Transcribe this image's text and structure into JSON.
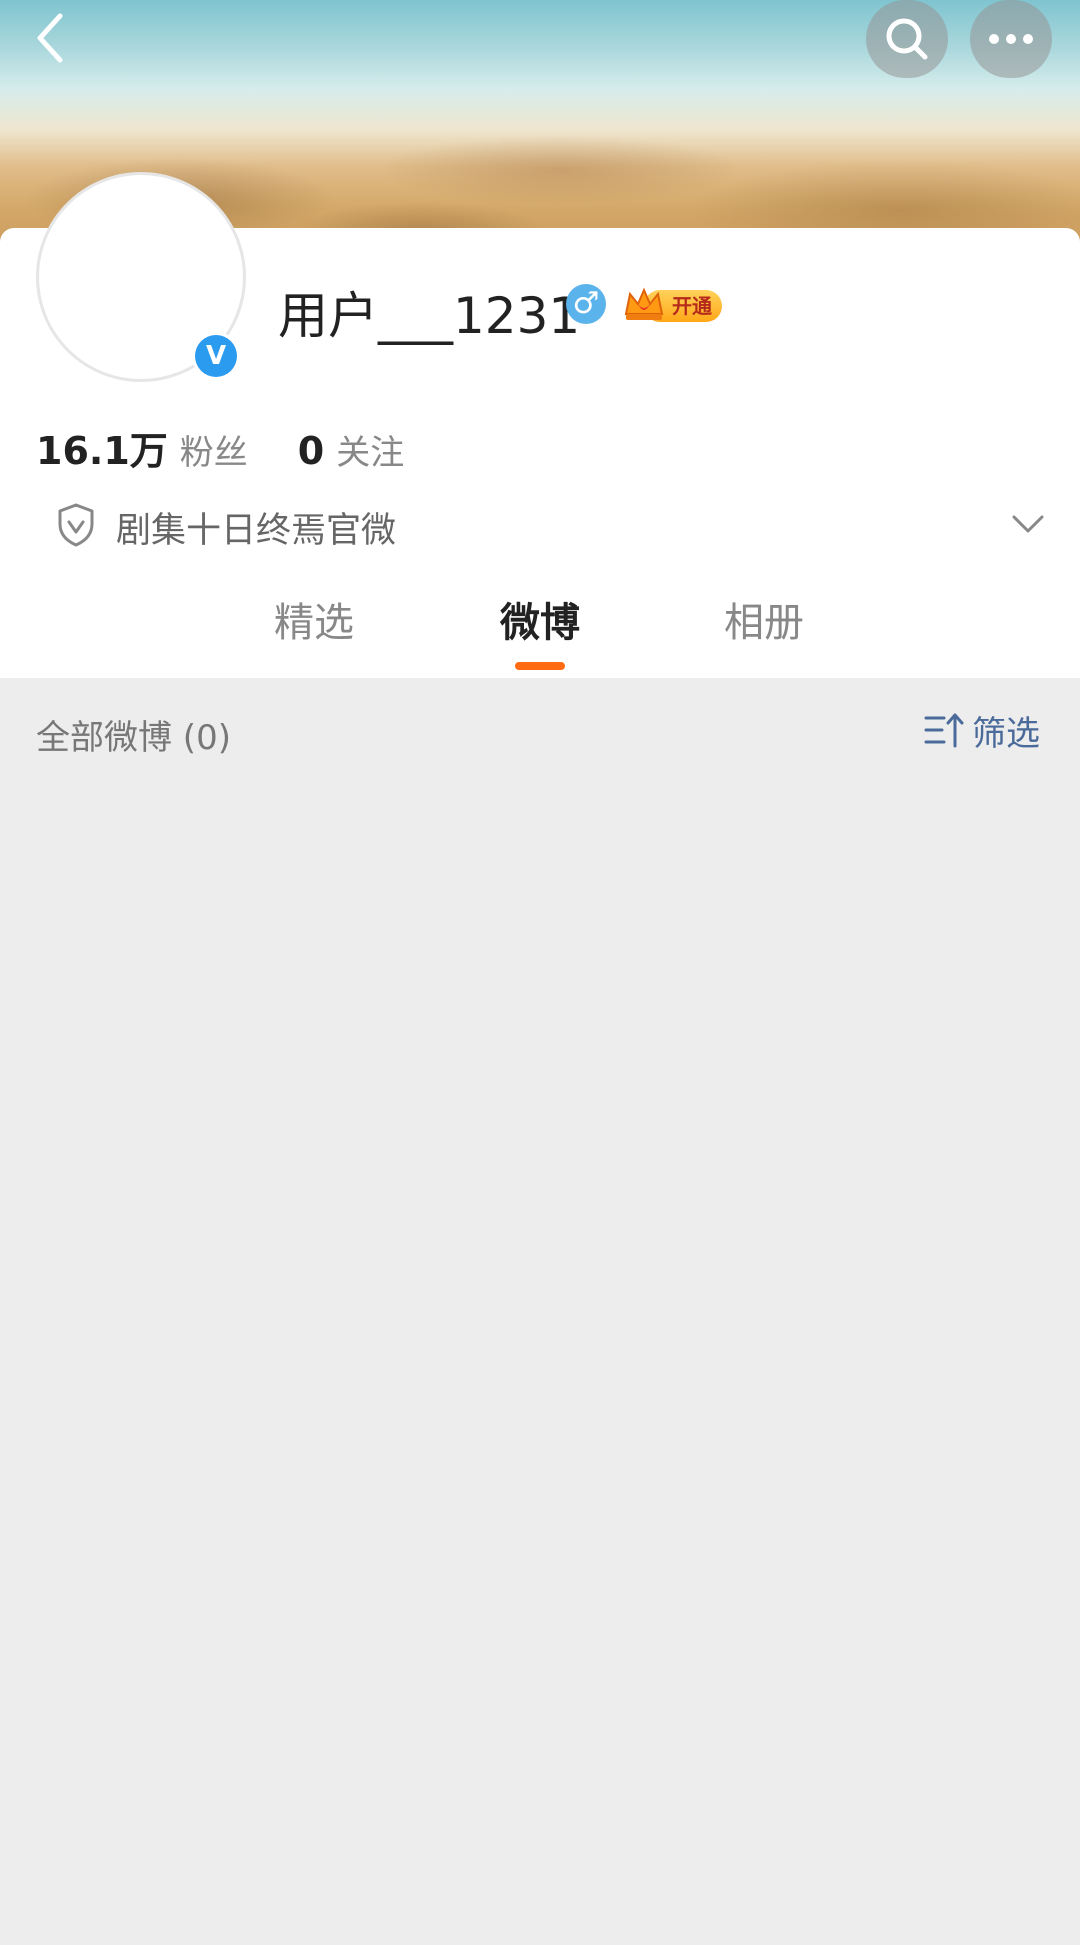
{
  "header": {
    "back_label": "back",
    "search_label": "search",
    "more_label": "more"
  },
  "profile": {
    "username": "用户___1231",
    "gender_symbol": "♂",
    "verify_mark": "V",
    "vip_label": "开通",
    "followers_count": "16.1万",
    "followers_label": "粉丝",
    "following_count": "0",
    "following_label": "关注",
    "verification_text": "剧集十日终焉官微"
  },
  "tabs": [
    {
      "label": "精选",
      "active": false
    },
    {
      "label": "微博",
      "active": true
    },
    {
      "label": "相册",
      "active": false
    }
  ],
  "feed": {
    "title": "全部微博 (0)",
    "filter_label": "筛选"
  },
  "colors": {
    "accent": "#ff6a13",
    "verify_blue": "#2a9bef",
    "link_blue": "#4a6a9a",
    "background": "#ededed"
  }
}
